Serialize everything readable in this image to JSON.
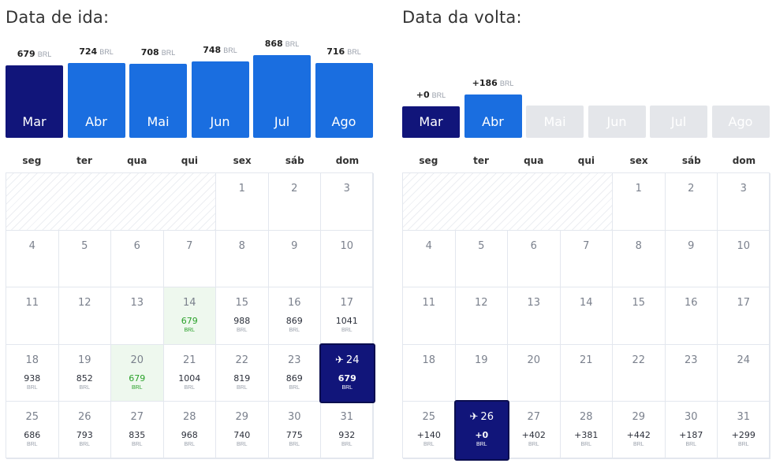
{
  "depart": {
    "title": "Data de ida:",
    "months": [
      {
        "label": "Mar",
        "price": "679",
        "currency": "BRL",
        "state": "selected",
        "value": 679
      },
      {
        "label": "Abr",
        "price": "724",
        "currency": "BRL",
        "state": "normal",
        "value": 724
      },
      {
        "label": "Mai",
        "price": "708",
        "currency": "BRL",
        "state": "normal",
        "value": 708
      },
      {
        "label": "Jun",
        "price": "748",
        "currency": "BRL",
        "state": "normal",
        "value": 748
      },
      {
        "label": "Jul",
        "price": "868",
        "currency": "BRL",
        "state": "normal",
        "value": 868
      },
      {
        "label": "Ago",
        "price": "716",
        "currency": "BRL",
        "state": "normal",
        "value": 716
      }
    ],
    "weekdays": [
      "seg",
      "ter",
      "qua",
      "qui",
      "sex",
      "sáb",
      "dom"
    ],
    "first_weekday_index": 4,
    "days": [
      {
        "d": "1"
      },
      {
        "d": "2"
      },
      {
        "d": "3"
      },
      {
        "d": "4"
      },
      {
        "d": "5"
      },
      {
        "d": "6"
      },
      {
        "d": "7"
      },
      {
        "d": "8"
      },
      {
        "d": "9"
      },
      {
        "d": "10"
      },
      {
        "d": "11"
      },
      {
        "d": "12"
      },
      {
        "d": "13"
      },
      {
        "d": "14",
        "price": "679",
        "cur": "BRL",
        "state": "cheap"
      },
      {
        "d": "15",
        "price": "988",
        "cur": "BRL"
      },
      {
        "d": "16",
        "price": "869",
        "cur": "BRL"
      },
      {
        "d": "17",
        "price": "1041",
        "cur": "BRL"
      },
      {
        "d": "18",
        "price": "938",
        "cur": "BRL"
      },
      {
        "d": "19",
        "price": "852",
        "cur": "BRL"
      },
      {
        "d": "20",
        "price": "679",
        "cur": "BRL",
        "state": "cheap"
      },
      {
        "d": "21",
        "price": "1004",
        "cur": "BRL"
      },
      {
        "d": "22",
        "price": "819",
        "cur": "BRL"
      },
      {
        "d": "23",
        "price": "869",
        "cur": "BRL"
      },
      {
        "d": "24",
        "price": "679",
        "cur": "BRL",
        "state": "selected",
        "icon": "plane-icon"
      },
      {
        "d": "25",
        "price": "686",
        "cur": "BRL"
      },
      {
        "d": "26",
        "price": "793",
        "cur": "BRL"
      },
      {
        "d": "27",
        "price": "835",
        "cur": "BRL"
      },
      {
        "d": "28",
        "price": "968",
        "cur": "BRL"
      },
      {
        "d": "29",
        "price": "740",
        "cur": "BRL"
      },
      {
        "d": "30",
        "price": "775",
        "cur": "BRL"
      },
      {
        "d": "31",
        "price": "932",
        "cur": "BRL"
      }
    ]
  },
  "return": {
    "title": "Data da volta:",
    "months": [
      {
        "label": "Mar",
        "price": "+0",
        "currency": "BRL",
        "state": "selected",
        "value": 0
      },
      {
        "label": "Abr",
        "price": "+186",
        "currency": "BRL",
        "state": "normal",
        "value": 186
      },
      {
        "label": "Mai",
        "price": "",
        "currency": "",
        "state": "disabled"
      },
      {
        "label": "Jun",
        "price": "",
        "currency": "",
        "state": "disabled"
      },
      {
        "label": "Jul",
        "price": "",
        "currency": "",
        "state": "disabled"
      },
      {
        "label": "Ago",
        "price": "",
        "currency": "",
        "state": "disabled"
      }
    ],
    "weekdays": [
      "seg",
      "ter",
      "qua",
      "qui",
      "sex",
      "sáb",
      "dom"
    ],
    "first_weekday_index": 4,
    "days": [
      {
        "d": "1"
      },
      {
        "d": "2"
      },
      {
        "d": "3"
      },
      {
        "d": "4"
      },
      {
        "d": "5"
      },
      {
        "d": "6"
      },
      {
        "d": "7"
      },
      {
        "d": "8"
      },
      {
        "d": "9"
      },
      {
        "d": "10"
      },
      {
        "d": "11"
      },
      {
        "d": "12"
      },
      {
        "d": "13"
      },
      {
        "d": "14"
      },
      {
        "d": "15"
      },
      {
        "d": "16"
      },
      {
        "d": "17"
      },
      {
        "d": "18"
      },
      {
        "d": "19"
      },
      {
        "d": "20"
      },
      {
        "d": "21"
      },
      {
        "d": "22"
      },
      {
        "d": "23"
      },
      {
        "d": "24"
      },
      {
        "d": "25",
        "price": "+140",
        "cur": "BRL"
      },
      {
        "d": "26",
        "price": "+0",
        "cur": "BRL",
        "state": "selected",
        "icon": "plane-icon"
      },
      {
        "d": "27",
        "price": "+402",
        "cur": "BRL"
      },
      {
        "d": "28",
        "price": "+381",
        "cur": "BRL"
      },
      {
        "d": "29",
        "price": "+442",
        "cur": "BRL"
      },
      {
        "d": "30",
        "price": "+187",
        "cur": "BRL"
      },
      {
        "d": "31",
        "price": "+299",
        "cur": "BRL"
      }
    ]
  },
  "colors": {
    "selected": "#11157a",
    "bar": "#1a6ee0",
    "disabled": "#e4e6ea",
    "cheap_bg": "#eef8ee",
    "cheap_text": "#2aa12a"
  }
}
